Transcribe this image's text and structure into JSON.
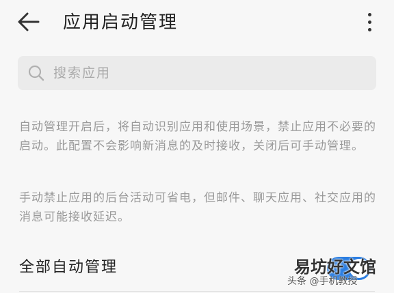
{
  "header": {
    "back_icon": "arrow-left-icon",
    "title": "应用启动管理",
    "more_icon": "more-vertical-icon"
  },
  "search": {
    "icon": "search-icon",
    "placeholder": "搜索应用"
  },
  "description": {
    "paragraph_1": "自动管理开启后，将自动识别应用和使用场景，禁止应用不必要的启动。此配置不会影响新消息的及时接收，关闭后可手动管理。",
    "paragraph_2": "手动禁止应用的后台活动可省电，但邮件、聊天应用、社交应用的消息可能接收延迟。"
  },
  "settings": {
    "auto_manage_all": {
      "label": "全部自动管理",
      "enabled": true
    }
  },
  "watermark": {
    "main": "易坊好文馆",
    "sub": "头条 @手机教授"
  },
  "colors": {
    "accent": "#2a7de1",
    "background": "#f7f7f7",
    "search_bg": "#ebebeb",
    "secondary_text": "#999999"
  }
}
